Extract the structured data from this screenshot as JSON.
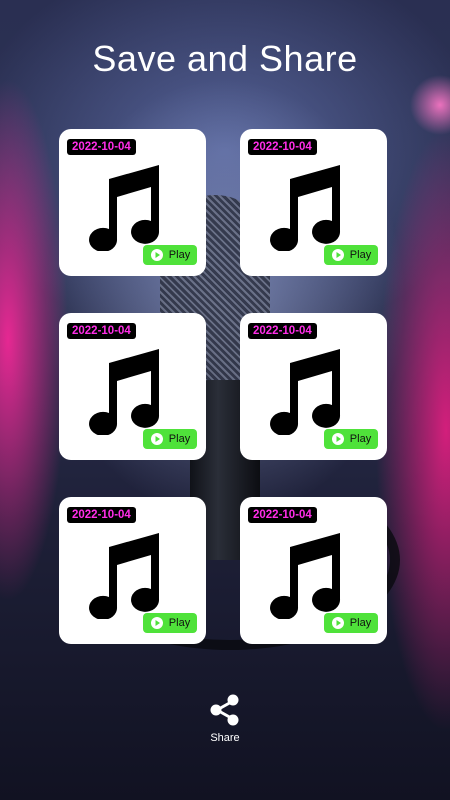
{
  "header": {
    "title": "Save and Share"
  },
  "recordings": [
    {
      "date": "2022-10-04",
      "play_label": "Play",
      "icon": "music-note-icon"
    },
    {
      "date": "2022-10-04",
      "play_label": "Play",
      "icon": "music-note-icon"
    },
    {
      "date": "2022-10-04",
      "play_label": "Play",
      "icon": "music-note-icon"
    },
    {
      "date": "2022-10-04",
      "play_label": "Play",
      "icon": "music-note-icon"
    },
    {
      "date": "2022-10-04",
      "play_label": "Play",
      "icon": "music-note-icon"
    },
    {
      "date": "2022-10-04",
      "play_label": "Play",
      "icon": "music-note-icon"
    }
  ],
  "footer": {
    "share_label": "Share",
    "share_icon": "share-icon"
  },
  "colors": {
    "date_text": "#ff2ee8",
    "date_bg": "#000000",
    "play_bg": "#4fe23a",
    "card_bg": "#ffffff",
    "title": "#ffffff"
  }
}
